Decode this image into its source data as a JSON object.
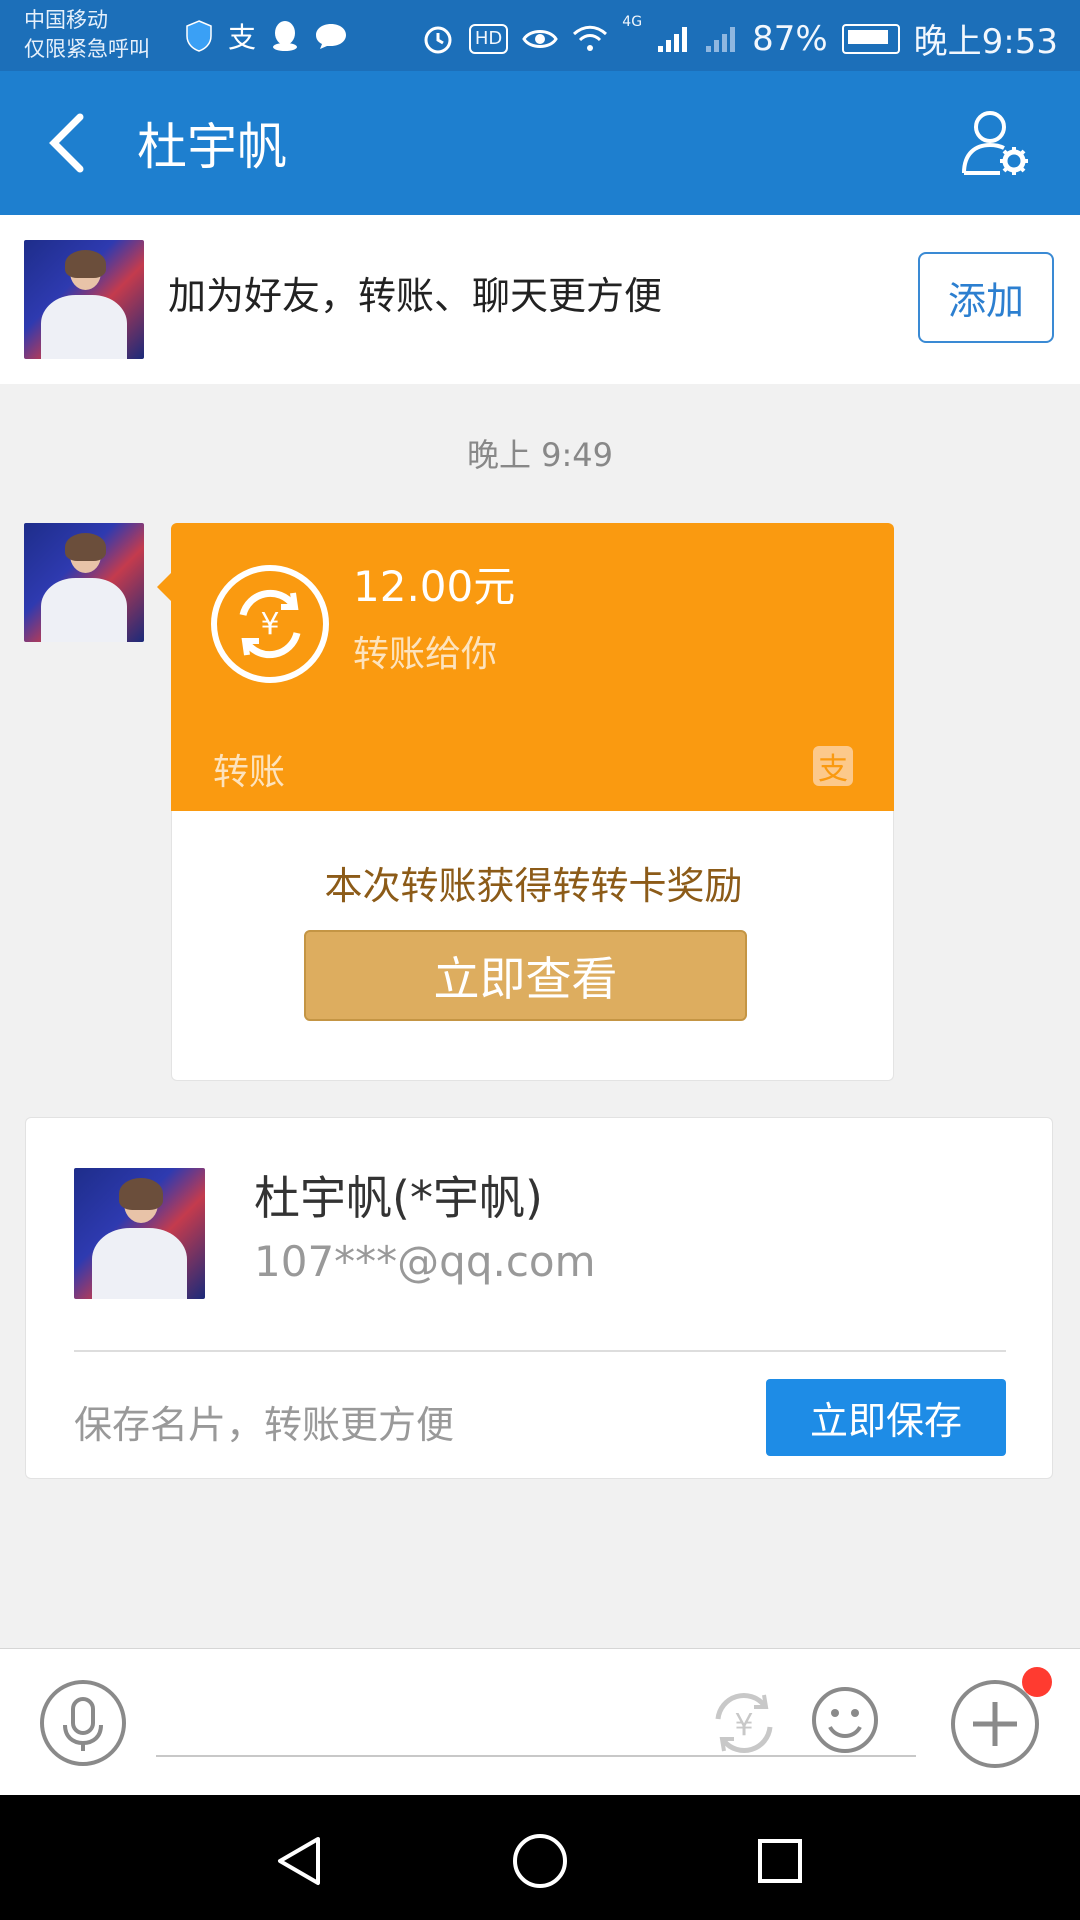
{
  "status_bar": {
    "carrier_line1": "中国移动",
    "carrier_line2": "仅限紧急呼叫",
    "hd_badge": "HD",
    "network": "4G",
    "battery": "87%",
    "time": "晚上9:53"
  },
  "header": {
    "title": "杜宇帆",
    "back_icon": "back-arrow-icon",
    "settings_icon": "profile-settings-icon"
  },
  "add_friend_banner": {
    "text": "加为好友，转账、聊天更方便",
    "button_label": "添加"
  },
  "timestamp": "晚上 9:49",
  "transfer_message": {
    "amount": "12.00元",
    "description": "转账给你",
    "tag": "转账",
    "alipay_glyph": "支",
    "reward_text": "本次转账获得转转卡奖励",
    "view_button_label": "立即查看",
    "accent_color": "#fa9a10"
  },
  "contact_card": {
    "name": "杜宇帆(*宇帆)",
    "email": "107***@qq.com",
    "save_hint": "保存名片，转账更方便",
    "save_button_label": "立即保存"
  },
  "input_bar": {
    "placeholder": ""
  }
}
